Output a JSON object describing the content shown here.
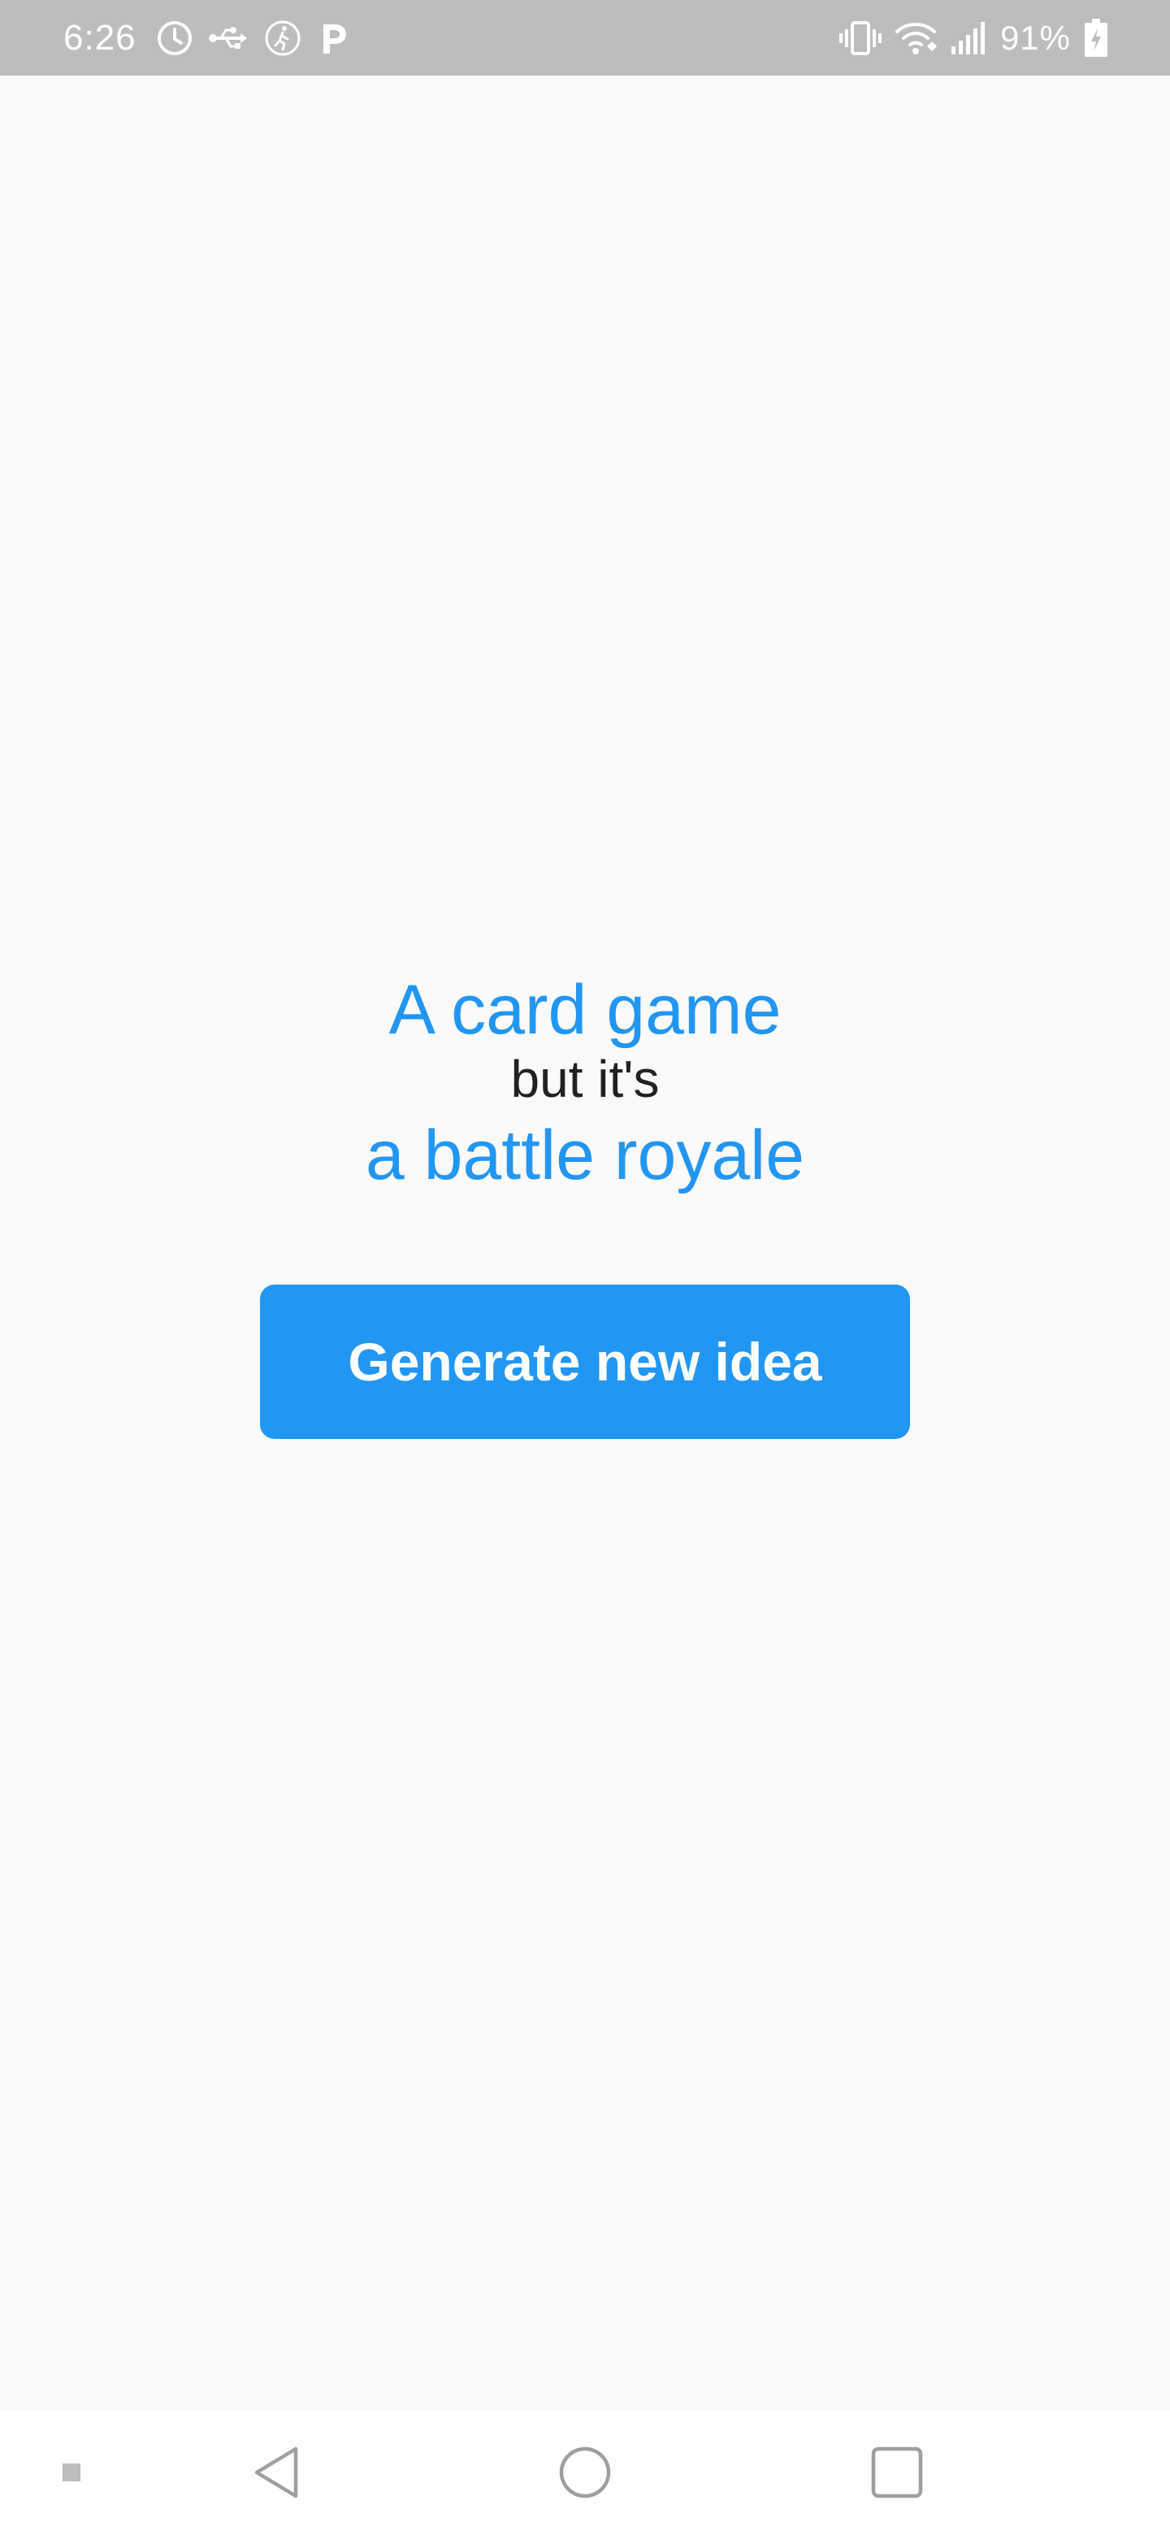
{
  "status_bar": {
    "time": "6:26",
    "battery_percent": "91%",
    "left_icons": [
      "alarm-clock-icon",
      "usb-icon",
      "activity-tracker-icon",
      "parking-app-icon"
    ],
    "right_icons": [
      "vibrate-icon",
      "wifi-icon",
      "signal-icon",
      "battery-charging-icon"
    ]
  },
  "idea": {
    "line1": "A card game",
    "connector": "but it's",
    "line2": "a battle royale"
  },
  "button": {
    "label": "Generate new idea"
  },
  "nav_bar": {
    "icons": [
      "nav-indicator-icon",
      "back-icon",
      "home-icon",
      "recents-icon"
    ]
  },
  "colors": {
    "accent": "#2196f3",
    "status_bar": "#bdbdbd",
    "background": "#fafafa",
    "text_dark": "#212121"
  }
}
